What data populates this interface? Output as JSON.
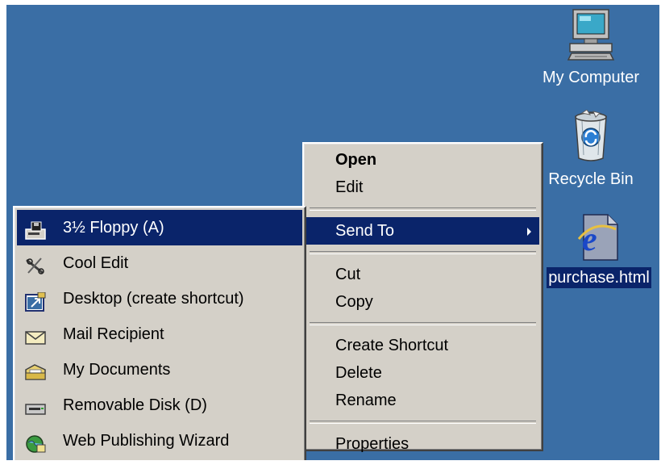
{
  "desktop": {
    "background": "#3a6ea5",
    "icons": [
      {
        "label": "My Computer",
        "icon": "computer-icon"
      },
      {
        "label": "Recycle Bin",
        "icon": "recycle-bin-icon"
      },
      {
        "label": "purchase.html",
        "icon": "internet-explorer-document-icon",
        "selected": true
      }
    ]
  },
  "context_menu": {
    "items": [
      {
        "label": "Open",
        "bold": true
      },
      {
        "label": "Edit"
      },
      {
        "label": "Send To",
        "submenu": true,
        "highlighted": true
      },
      {
        "label": "Cut"
      },
      {
        "label": "Copy"
      },
      {
        "label": "Create Shortcut"
      },
      {
        "label": "Delete"
      },
      {
        "label": "Rename"
      },
      {
        "label": "Properties"
      }
    ]
  },
  "send_to_menu": {
    "items": [
      {
        "label": "3½ Floppy (A)",
        "icon": "floppy-drive-icon",
        "highlighted": true
      },
      {
        "label": "Cool Edit",
        "icon": "cool-edit-icon"
      },
      {
        "label": "Desktop (create shortcut)",
        "icon": "desktop-shortcut-icon"
      },
      {
        "label": "Mail Recipient",
        "icon": "mail-envelope-icon"
      },
      {
        "label": "My Documents",
        "icon": "my-documents-folder-icon"
      },
      {
        "label": "Removable Disk (D)",
        "icon": "removable-disk-icon"
      },
      {
        "label": "Web Publishing Wizard",
        "icon": "web-publishing-wizard-icon"
      }
    ]
  },
  "colors": {
    "menu_face": "#d4d0c8",
    "highlight": "#0a246a",
    "highlight_text": "#ffffff"
  }
}
